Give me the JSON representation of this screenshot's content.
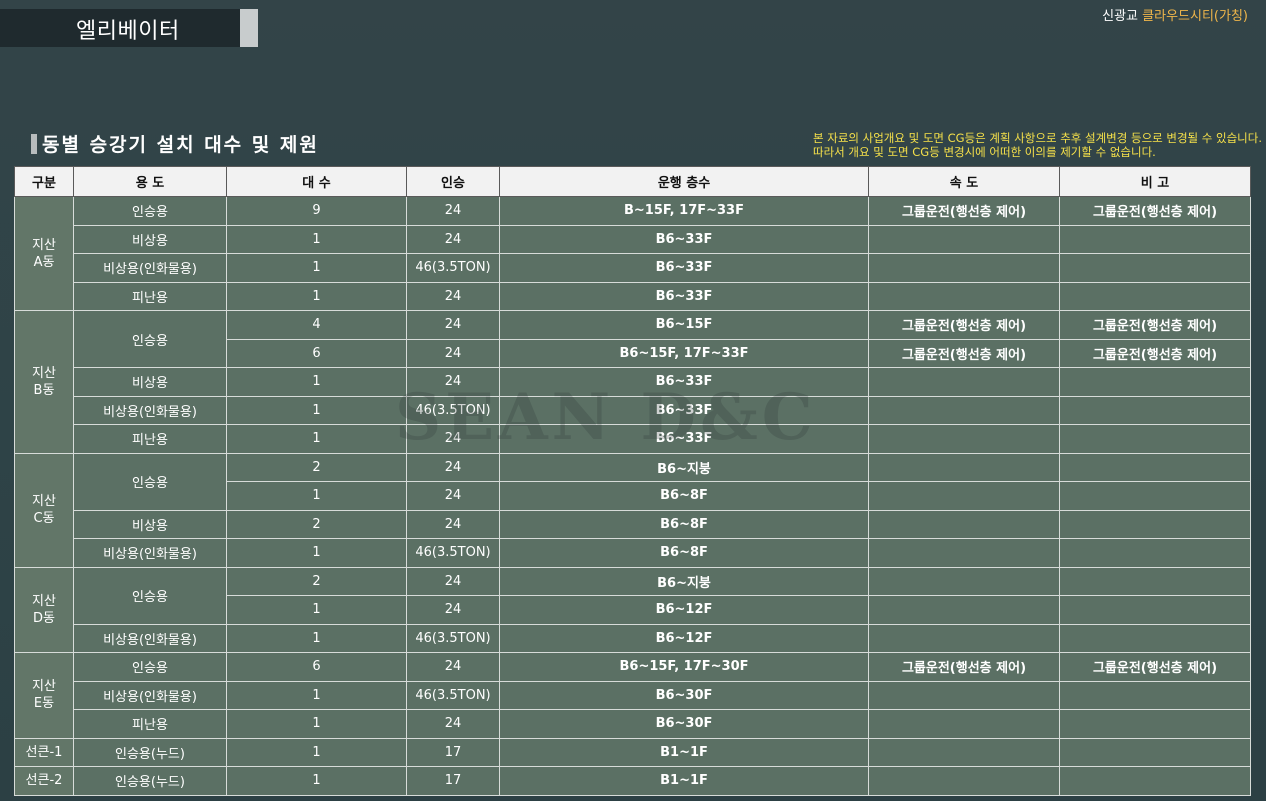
{
  "page": {
    "title": "엘리베이터"
  },
  "brand": {
    "place": "신광교",
    "name": "클라우드시티(가칭)"
  },
  "section_title": "동별 승강기 설치 대수 및 제원",
  "notice": [
    "본 자료의 사업개요 및 도면 CG등은 계획 사항으로 추후 설계변경 등으로 변경될 수 있습니다.",
    "따라서 개요 및 도면 CG등 변경시에 어떠한 이의를 제기할 수 없습니다."
  ],
  "watermark": "SEAN D&C",
  "table": {
    "headers": [
      "구분",
      "용 도",
      "대 수",
      "인승",
      "운행 층수",
      "속 도",
      "비 고"
    ],
    "groups": [
      {
        "label": [
          "지산",
          "A동"
        ],
        "rows": [
          {
            "use": "인승용",
            "count": "9",
            "cap": "24",
            "floors": "B~15F, 17F~33F",
            "speed": "그룹운전(행선층 제어)",
            "note": "그룹운전(행선층 제어)"
          },
          {
            "use": "비상용",
            "count": "1",
            "cap": "24",
            "floors": "B6~33F",
            "speed": "",
            "note": ""
          },
          {
            "use": "비상용(인화물용)",
            "count": "1",
            "cap": "46(3.5TON)",
            "floors": "B6~33F",
            "speed": "",
            "note": ""
          },
          {
            "use": "피난용",
            "count": "1",
            "cap": "24",
            "floors": "B6~33F",
            "speed": "",
            "note": ""
          }
        ]
      },
      {
        "label": [
          "지산",
          "B동"
        ],
        "rows": [
          {
            "use": "인승용",
            "count": "4",
            "cap": "24",
            "floors": "B6~15F",
            "speed": "그룹운전(행선층 제어)",
            "note": "그룹운전(행선층 제어)"
          },
          {
            "use": "",
            "count": "6",
            "cap": "24",
            "floors": "B6~15F, 17F~33F",
            "speed": "그룹운전(행선층 제어)",
            "note": "그룹운전(행선층 제어)"
          },
          {
            "use": "비상용",
            "count": "1",
            "cap": "24",
            "floors": "B6~33F",
            "speed": "",
            "note": ""
          },
          {
            "use": "비상용(인화물용)",
            "count": "1",
            "cap": "46(3.5TON)",
            "floors": "B6~33F",
            "speed": "",
            "note": ""
          },
          {
            "use": "피난용",
            "count": "1",
            "cap": "24",
            "floors": "B6~33F",
            "speed": "",
            "note": ""
          }
        ]
      },
      {
        "label": [
          "지산",
          "C동"
        ],
        "rows": [
          {
            "use": "인승용",
            "count": "2",
            "cap": "24",
            "floors": "B6~지붕",
            "speed": "",
            "note": ""
          },
          {
            "use": "",
            "count": "1",
            "cap": "24",
            "floors": "B6~8F",
            "speed": "",
            "note": ""
          },
          {
            "use": "비상용",
            "count": "2",
            "cap": "24",
            "floors": "B6~8F",
            "speed": "",
            "note": ""
          },
          {
            "use": "비상용(인화물용)",
            "count": "1",
            "cap": "46(3.5TON)",
            "floors": "B6~8F",
            "speed": "",
            "note": ""
          }
        ]
      },
      {
        "label": [
          "지산",
          "D동"
        ],
        "rows": [
          {
            "use": "인승용",
            "count": "2",
            "cap": "24",
            "floors": "B6~지붕",
            "speed": "",
            "note": ""
          },
          {
            "use": "",
            "count": "1",
            "cap": "24",
            "floors": "B6~12F",
            "speed": "",
            "note": ""
          },
          {
            "use": "비상용(인화물용)",
            "count": "1",
            "cap": "46(3.5TON)",
            "floors": "B6~12F",
            "speed": "",
            "note": ""
          }
        ]
      },
      {
        "label": [
          "지산",
          "E동"
        ],
        "rows": [
          {
            "use": "인승용",
            "count": "6",
            "cap": "24",
            "floors": "B6~15F, 17F~30F",
            "speed": "그룹운전(행선층 제어)",
            "note": "그룹운전(행선층 제어)"
          },
          {
            "use": "비상용(인화물용)",
            "count": "1",
            "cap": "46(3.5TON)",
            "floors": "B6~30F",
            "speed": "",
            "note": ""
          },
          {
            "use": "피난용",
            "count": "1",
            "cap": "24",
            "floors": "B6~30F",
            "speed": "",
            "note": ""
          }
        ]
      },
      {
        "label": [
          "선큰-1"
        ],
        "rows": [
          {
            "use": "인승용(누드)",
            "count": "1",
            "cap": "17",
            "floors": "B1~1F",
            "speed": "",
            "note": ""
          }
        ]
      },
      {
        "label": [
          "선큰-2"
        ],
        "rows": [
          {
            "use": "인승용(누드)",
            "count": "1",
            "cap": "17",
            "floors": "B1~1F",
            "speed": "",
            "note": ""
          }
        ]
      }
    ]
  }
}
